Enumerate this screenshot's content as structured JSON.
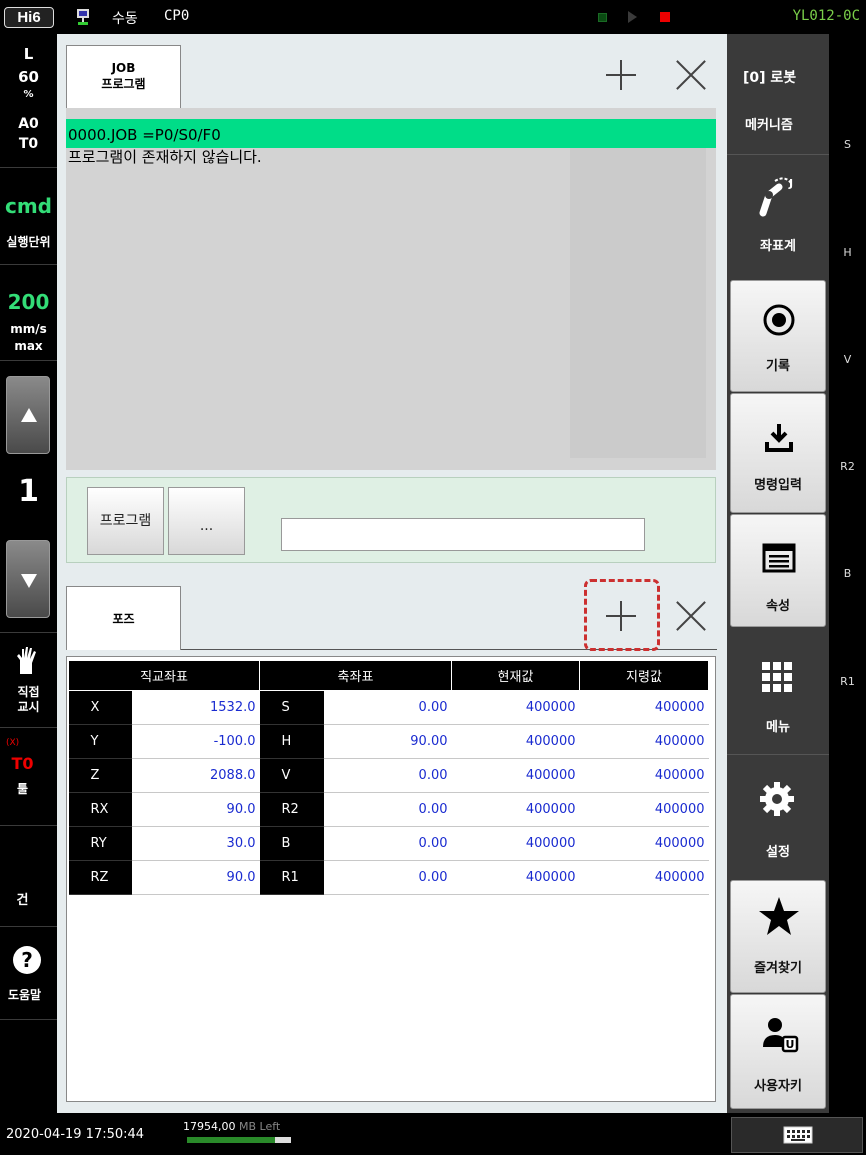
{
  "topbar": {
    "logo": "Hi6",
    "mode": "수동",
    "program_counter": "CP0",
    "controller_id": "YL012-0C"
  },
  "left": {
    "speed_mode_label": "L",
    "speed_percent": "60",
    "speed_unit": "%",
    "acc_label": "A0",
    "tool_label": "T0",
    "cmd_label": "cmd",
    "exec_unit_label": "실행단위",
    "speed_value": "200",
    "speed_unit_mm": "mm/s",
    "speed_max": "max",
    "step_value": "1",
    "direct_teach_line1": "직접",
    "direct_teach_line2": "교시",
    "tool_error_mark": "(X)",
    "tool_id": "T0",
    "tool_label_text": "툴",
    "gun_label": "건",
    "help_label": "도움말"
  },
  "job_panel": {
    "tab_line1": "JOB",
    "tab_line2": "프로그램",
    "line1": "0000.JOB  =P0/S0/F0",
    "line2": "프로그램이 존재하지 않습니다.",
    "program_button": "프로그램",
    "more_button": "..."
  },
  "pose_panel": {
    "tab_label": "포즈",
    "headers": [
      "직교좌표",
      "축좌표",
      "현재값",
      "지령값"
    ],
    "rows": [
      {
        "c_label": "X",
        "c_value": "1532.0",
        "a_label": "S",
        "a_value": "0.00",
        "current": "400000",
        "command": "400000"
      },
      {
        "c_label": "Y",
        "c_value": "-100.0",
        "a_label": "H",
        "a_value": "90.00",
        "current": "400000",
        "command": "400000"
      },
      {
        "c_label": "Z",
        "c_value": "2088.0",
        "a_label": "V",
        "a_value": "0.00",
        "current": "400000",
        "command": "400000"
      },
      {
        "c_label": "RX",
        "c_value": "90.0",
        "a_label": "R2",
        "a_value": "0.00",
        "current": "400000",
        "command": "400000"
      },
      {
        "c_label": "RY",
        "c_value": "30.0",
        "a_label": "B",
        "a_value": "0.00",
        "current": "400000",
        "command": "400000"
      },
      {
        "c_label": "RZ",
        "c_value": "90.0",
        "a_label": "R1",
        "a_value": "0.00",
        "current": "400000",
        "command": "400000"
      }
    ]
  },
  "right": {
    "robot_label": "[0] 로봇",
    "mechanism_label": "메커니즘",
    "coord_label": "좌표계",
    "record_label": "기록",
    "command_input_label": "명령입력",
    "attribute_label": "속성",
    "menu_label": "메뉴",
    "settings_label": "설정",
    "favorites_label": "즐겨찾기",
    "user_key_label": "사용자키"
  },
  "axes": [
    "S",
    "H",
    "V",
    "R2",
    "B",
    "R1"
  ],
  "bottom": {
    "datetime": "2020-04-19 17:50:44",
    "memory_value": "17954,00",
    "memory_unit": "MB Left",
    "memory_used_fraction": 0.85
  },
  "colors": {
    "highlight": "#00dd88",
    "cmd_green": "#33dd77",
    "value_blue": "#1a2bd0",
    "alert_red": "#e00000"
  }
}
